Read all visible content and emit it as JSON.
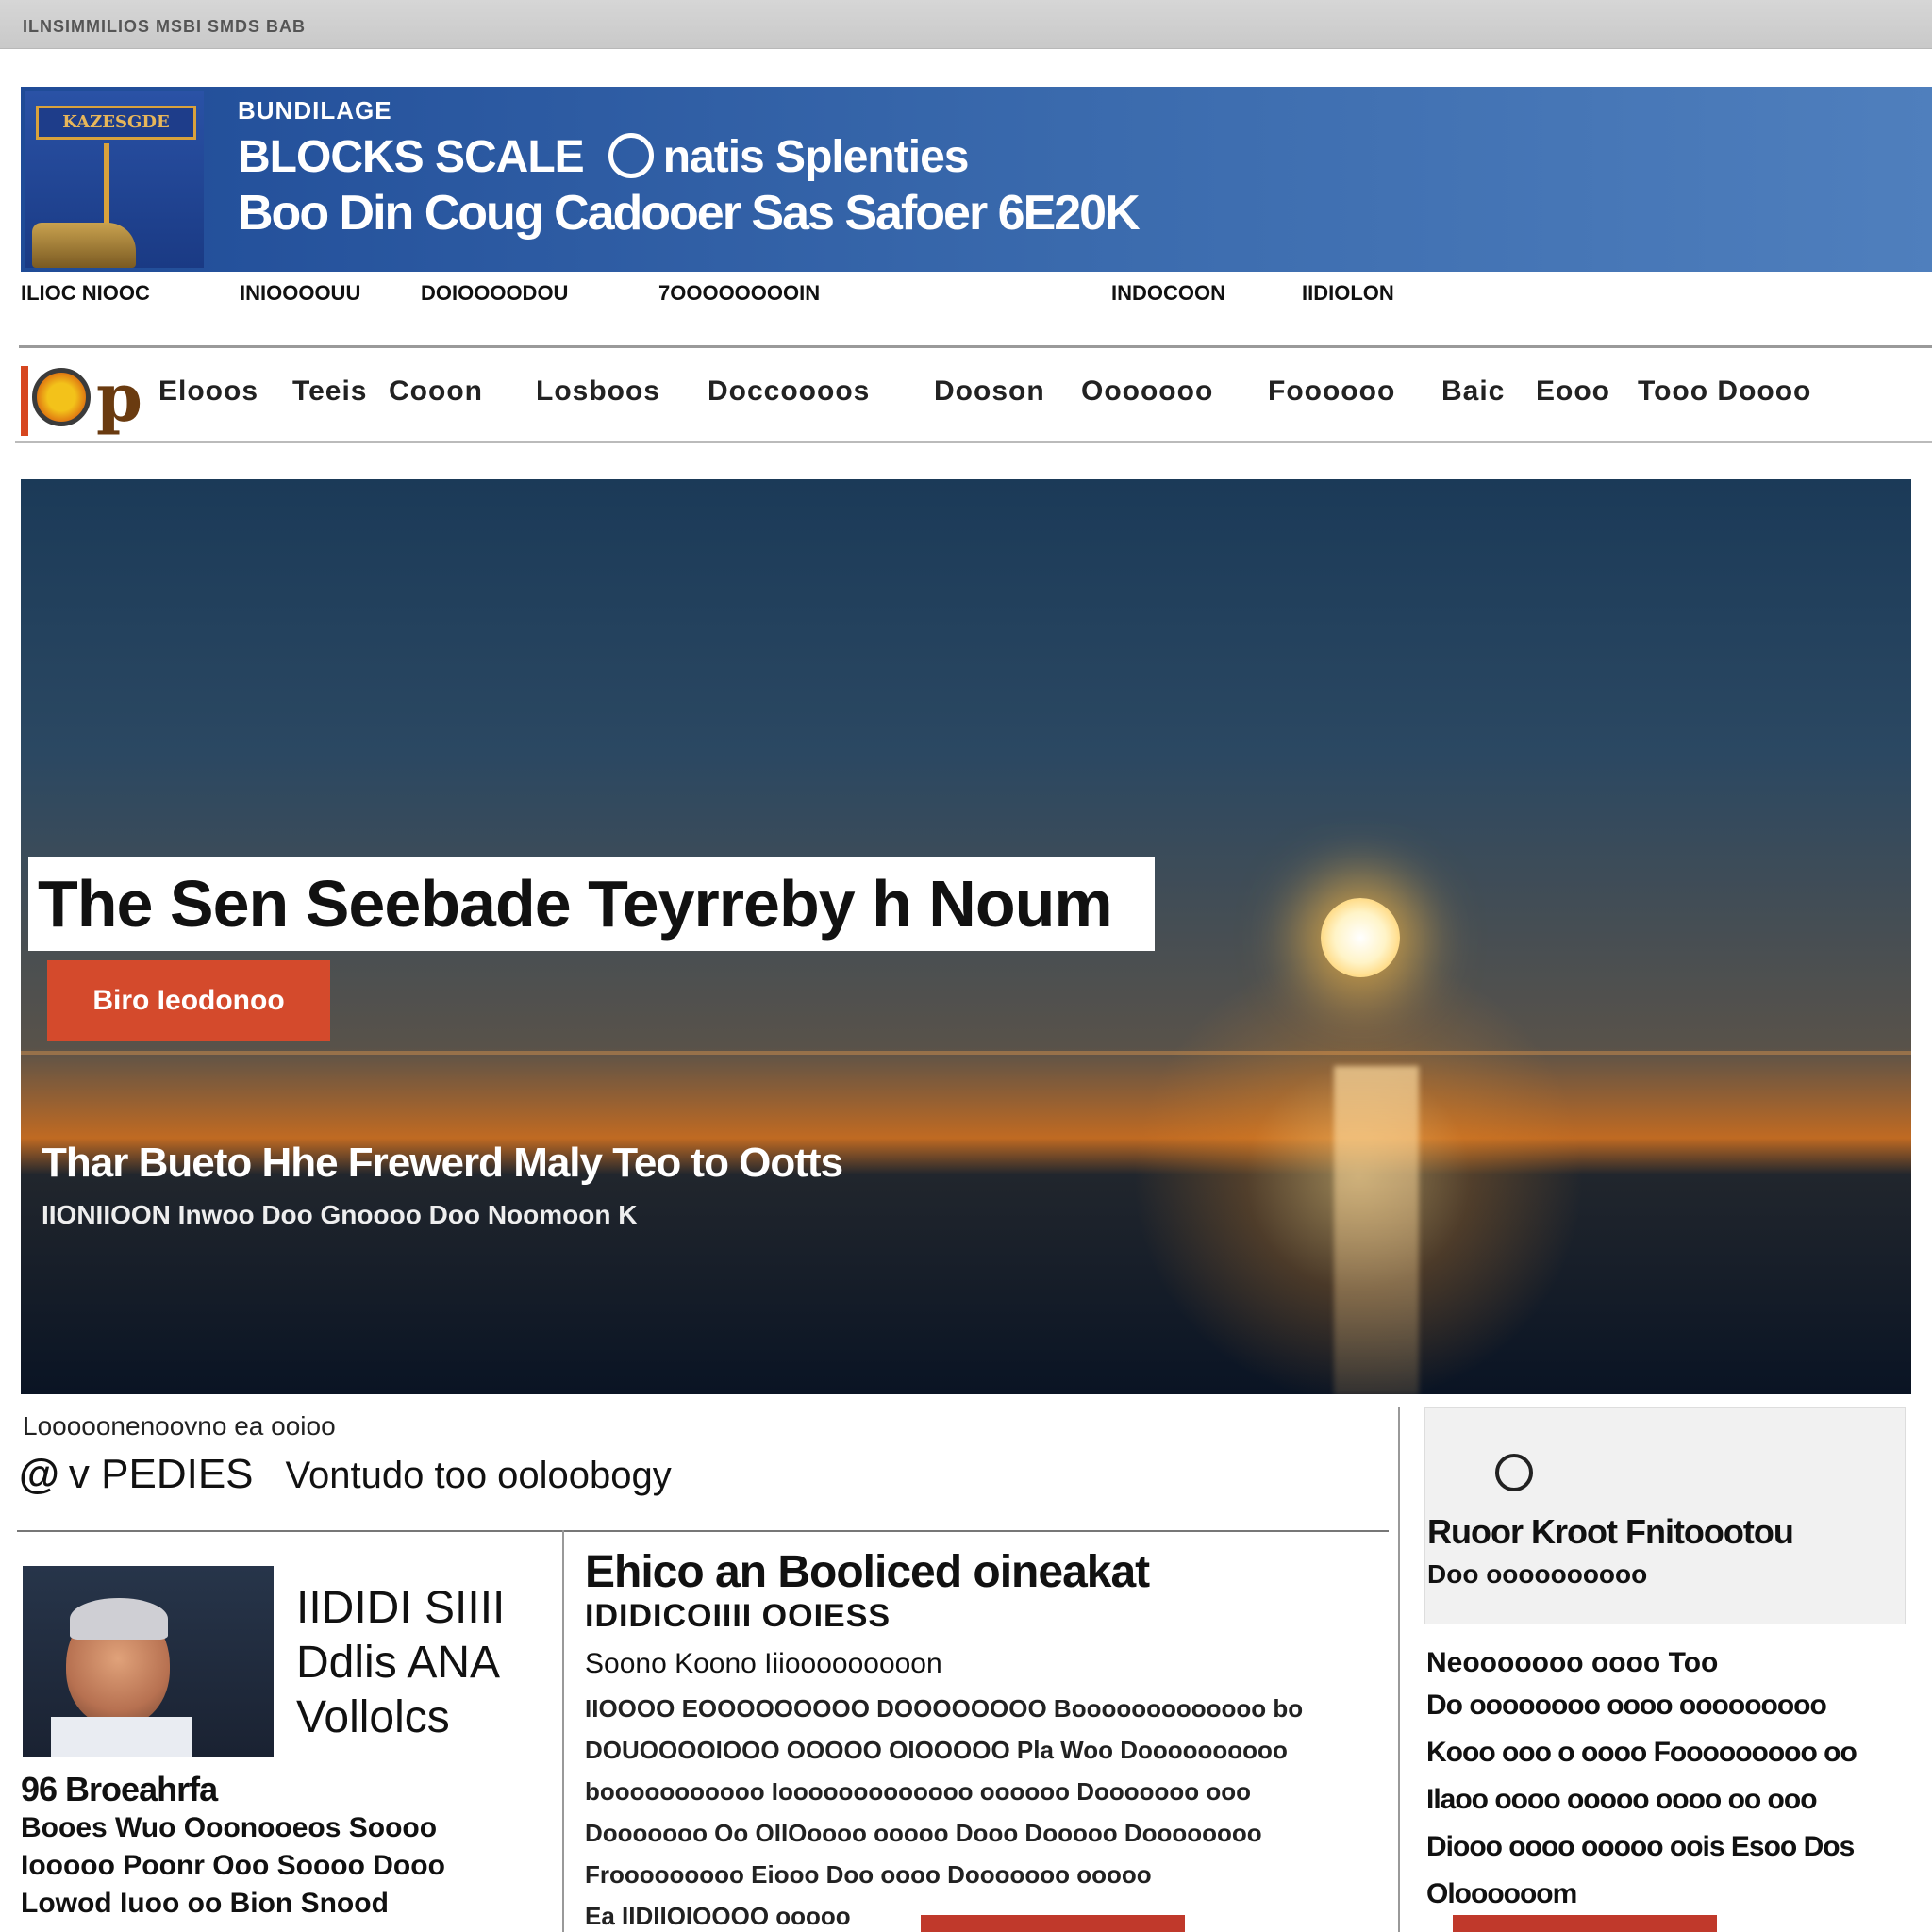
{
  "browser": {
    "tab_text": "ILNSIMMILIOS MSBI SMDS BAB"
  },
  "banner": {
    "logo_sign": "KAZESGDE",
    "kicker": "BUNDILAGE",
    "line1_a": "BLOCKS SCALE",
    "line1_b": "natis Splenties",
    "line2": "Boo Din Coug Cadooer Sas Safoer 6E20K"
  },
  "util_links": [
    "ILIOC NIOOC",
    "INIOOOOUU",
    "DOIOOOODOU",
    "7OOOOOOOOIN",
    "INDOCOON",
    "IIDIOLON"
  ],
  "nav": {
    "logo_letter": "p",
    "items": [
      "Elooos",
      "Teeis",
      "Cooon",
      "Losboos",
      "Doccoooos",
      "Dooson",
      "Ooooooo",
      "Foooooo",
      "Baic",
      "Eooo",
      "Tooo Doooo"
    ]
  },
  "hero": {
    "title": "The Sen Seebade Teyrreby h Noum",
    "tag": "Biro Ieodonoo",
    "subtitle": "Thar Bueto Hhe Frewerd Maly Teo to Ootts",
    "meta": "IIONIIOON Inwoo Doo Gnoooo Doo Noomoon K"
  },
  "section": {
    "small_label": "Looooonenoovno ea ooioo",
    "at_symbol": "@",
    "head": "v PEDIES",
    "tagline": "Vontudo too ooloobogy"
  },
  "left_col": {
    "side_title_lines": [
      "IIDIDI SIIII",
      "Ddlis ANA",
      "Vollolcs"
    ],
    "story_head": "96 Broeahrfa",
    "story_lines": [
      "Booes Wuo Ooonooeos Soooo",
      "Iooooo Poonr Ooo Soooo Dooo",
      "Lowod Iuoo oo Bion Snood"
    ]
  },
  "mid_col": {
    "headline": "Ehico an Booliced oineakat",
    "subhead": "IDIDICOIIII OOIESS",
    "byline": "Soono Koono Iiiooooooooon",
    "body_lines": [
      "IIOOOO EOOOOOOOOO DOOOOOOOO Booooooooooooo bo",
      "DOUOOOOIOOO OOOOO OIOOOOO Pla Woo Doooooooooo",
      "booooooooooo Iooooooooooooo oooooo Dooooooo ooo",
      "Dooooooo Oo OIIOoooo ooooo Dooo Dooooo Doooooooo",
      "Frooooooooo Eiooo Doo oooo Dooooooo ooooo",
      "Ea IIDIIOIOOOO ooooo"
    ]
  },
  "right_col": {
    "box_title": "Ruoor Kroot Fnitoootou",
    "box_sub": "Doo oooooooooo",
    "story_head": "Neooooooo oooo Too",
    "story_lines": [
      "Do oooooooo oooo ooooooooo",
      "Kooo ooo o oooo Fooooooooo oo",
      "Ilaoo oooo ooooo oooo oo ooo",
      "Diooo oooo ooooo oois Esoo Dos",
      "Oloooooom"
    ]
  }
}
